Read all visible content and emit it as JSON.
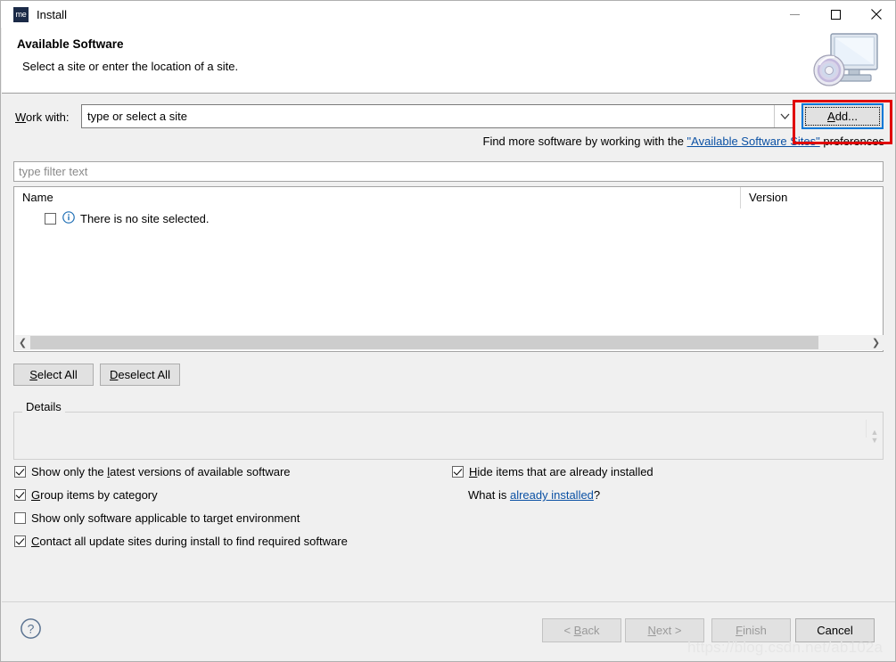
{
  "window": {
    "icon_name": "me-app-icon",
    "icon_text": "me",
    "title": "Install",
    "controls": {
      "minimize": "minimize-icon",
      "maximize": "maximize-icon",
      "close": "close-icon"
    }
  },
  "header": {
    "title": "Available Software",
    "subtitle": "Select a site or enter the location of a site.",
    "banner_icon": "monitor-with-disc-icon"
  },
  "work_with": {
    "label_prefix": "W",
    "label_rest": "ork with:",
    "combo_value": "type or select a site",
    "dropdown_icon": "chevron-down-icon",
    "add_button": {
      "prefix": "A",
      "rest": "dd..."
    }
  },
  "find_more": {
    "before": "Find more software by working with the ",
    "link": "\"Available Software Sites\"",
    "after": " preferences"
  },
  "filter": {
    "placeholder": "type filter text",
    "value": ""
  },
  "table": {
    "columns": [
      "Name",
      "Version"
    ],
    "rows": [
      {
        "checked": false,
        "icon": "info-icon",
        "name": "There is no site selected.",
        "version": ""
      }
    ],
    "hscroll": {
      "left_arrow": "scroll-left-icon",
      "right_arrow": "scroll-right-icon"
    }
  },
  "selection_buttons": {
    "select_all": {
      "prefix": "S",
      "rest": "elect All"
    },
    "deselect_all": {
      "prefix": "D",
      "rest": "eselect All"
    }
  },
  "details": {
    "legend": "Details",
    "content": "",
    "scroll_up": "scroll-up-icon",
    "scroll_down": "scroll-down-icon"
  },
  "options": {
    "left": [
      {
        "checked": true,
        "before": "Show only the ",
        "mnemonic": "l",
        "after": "atest versions of available software"
      },
      {
        "checked": true,
        "before": "",
        "mnemonic": "G",
        "after": "roup items by category"
      },
      {
        "checked": false,
        "before": "",
        "mnemonic": "S",
        "after": "how only software applicable to target environment"
      },
      {
        "checked": true,
        "before": "",
        "mnemonic": "C",
        "after": "ontact all update sites during install to find required software"
      }
    ],
    "right": {
      "checkbox": {
        "checked": true,
        "before": "",
        "mnemonic": "H",
        "after": "ide items that are already installed"
      },
      "what_is": {
        "before": "What is ",
        "link": "already installed",
        "after": "?"
      }
    }
  },
  "footer": {
    "help_icon": "help-question-icon",
    "buttons": [
      {
        "prefix": "< ",
        "mnemonic": "B",
        "rest": "ack",
        "enabled": false
      },
      {
        "prefix": "",
        "mnemonic": "N",
        "rest": "ext >",
        "enabled": false
      },
      {
        "prefix": "",
        "mnemonic": "F",
        "rest": "inish",
        "enabled": false
      },
      {
        "prefix": "",
        "mnemonic": "",
        "rest": "Cancel",
        "enabled": true
      }
    ]
  },
  "watermark": "https://blog.csdn.net/ab102a",
  "colors": {
    "dialog_bg": "#f0f0f0",
    "white": "#ffffff",
    "link": "#0b51a4",
    "focus_blue": "#0078d7",
    "annotation_red": "#e00000",
    "disabled_text": "#9a9a9a"
  }
}
